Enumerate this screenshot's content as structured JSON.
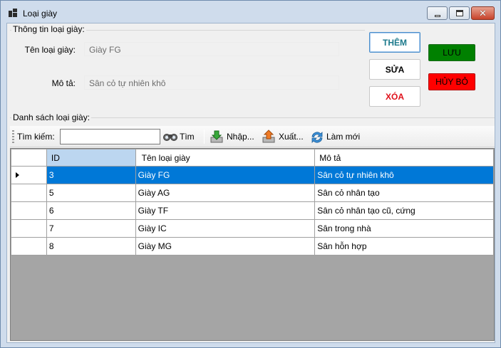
{
  "window": {
    "title": "Loại giày"
  },
  "info_group": {
    "label": "Thông tin loại giày:",
    "name_label": "Tên loại giày:",
    "name_value": "Giày FG",
    "desc_label": "Mô tả:",
    "desc_value": "Sân cỏ tự nhiên khô"
  },
  "actions": {
    "add": "THÊM",
    "edit": "SỬA",
    "delete": "XÓA",
    "save": "LƯU",
    "cancel": "HỦY BỎ"
  },
  "colors": {
    "add_text": "#1d7a8c",
    "edit_text": "#000000",
    "delete_text": "#e0101a",
    "save_bg": "#008000",
    "cancel_bg": "#ff0000",
    "selected_row": "#0078d7"
  },
  "list_group": {
    "label": "Danh sách loại giày:"
  },
  "toolbar": {
    "search_label": "Tìm kiếm:",
    "search_value": "",
    "find": "Tìm",
    "import": "Nhập...",
    "export": "Xuất...",
    "refresh": "Làm mới",
    "icons": [
      "binoculars-icon",
      "import-icon",
      "export-icon",
      "refresh-icon"
    ]
  },
  "table": {
    "columns": [
      "ID",
      "Tên loại giày",
      "Mô tả"
    ],
    "rows": [
      {
        "id": "3",
        "name": "Giày FG",
        "desc": "Sân cỏ tự nhiên khô",
        "selected": true
      },
      {
        "id": "5",
        "name": "Giày AG",
        "desc": "Sân cỏ nhân tạo",
        "selected": false
      },
      {
        "id": "6",
        "name": "Giày TF",
        "desc": "Sân cỏ nhân tạo cũ, cứng",
        "selected": false
      },
      {
        "id": "7",
        "name": "Giày IC",
        "desc": "Sân trong nhà",
        "selected": false
      },
      {
        "id": "8",
        "name": "Giày MG",
        "desc": "Sân hỗn hợp",
        "selected": false
      }
    ]
  }
}
